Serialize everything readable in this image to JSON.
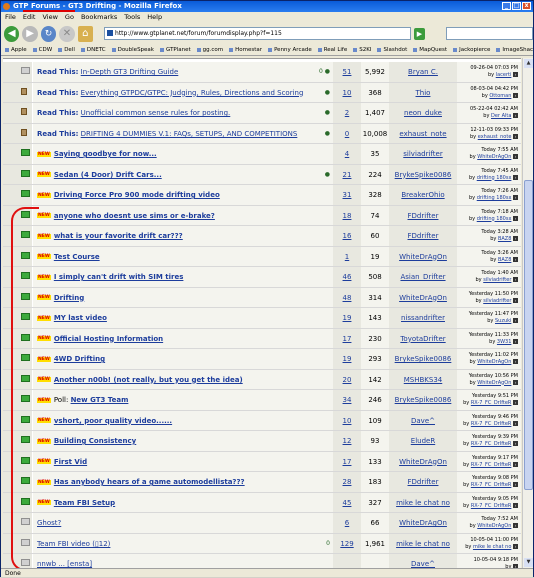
{
  "window": {
    "title_pre": "GTP Forums - ",
    "title_hl": "GT3 Drifting",
    "title_post": " - Mozilla Firefox",
    "min": "_",
    "max": "□",
    "close": "x"
  },
  "menu": [
    "File",
    "Edit",
    "View",
    "Go",
    "Bookmarks",
    "Tools",
    "Help"
  ],
  "nav": {
    "url": "http://www.gtplanet.net/forum/forumdisplay.php?f=115",
    "back_glyph": "◀",
    "fwd_glyph": "▶",
    "reload_glyph": "↻",
    "stop_glyph": "✕",
    "home_glyph": "⌂",
    "go_glyph": "▶"
  },
  "bookmarks": [
    "Apple",
    "CDW",
    "Dell",
    "DNETC",
    "DoubleSpeak",
    "GTPlanet",
    "gg.com",
    "Homestar",
    "Penny Arcade",
    "Real Life",
    "S2KI",
    "Slashdot",
    "MapQuest",
    "Jackopierce",
    "ImageShack"
  ],
  "status": "Done",
  "threads": [
    {
      "type": "readthis",
      "prefix": "Read This:",
      "title": "In-Depth GT3 Drifting Guide",
      "icons": "0 ●",
      "replies": "51",
      "views": "5,992",
      "author": "Bryan C.",
      "date": "09-26-04 07:03 PM",
      "by": "lacerti",
      "icon": "grey"
    },
    {
      "type": "readthis",
      "prefix": "Read This:",
      "title": "Everything GTPDC/GTPC: Judging, Rules, Directions and Scoring",
      "icons": "●",
      "replies": "10",
      "views": "368",
      "author": "Thio",
      "date": "08-03-04 04:42 PM",
      "by": "Ottoman",
      "icon": "lock"
    },
    {
      "type": "readthis",
      "prefix": "Read This:",
      "title": "Unofficial common sense rules for posting.",
      "icons": "●",
      "replies": "2",
      "views": "1,407",
      "author": "neon_duke",
      "date": "05-22-04 02:42 AM",
      "by": "Der Alta",
      "icon": "lock"
    },
    {
      "type": "readthis",
      "prefix": "Read This:",
      "title": "DRIFTING 4 DUMMIES V.1: FAQs, SETUPS, AND COMPETITIONS",
      "icons": "●",
      "replies": "0",
      "views": "10,008",
      "author": "exhaust_note",
      "date": "12-11-03 09:33 PM",
      "by": "exhaust_note",
      "icon": "lock"
    },
    {
      "type": "new",
      "title": "Saying goodbye for now...",
      "icons": "",
      "replies": "4",
      "views": "35",
      "author": "silviadrifter",
      "date": "Today 7:55 AM",
      "by": "WhiteDrAgOn",
      "icon": "green"
    },
    {
      "type": "new",
      "title": "Sedan (4 Door) Drift Cars...",
      "icons": "●",
      "replies": "21",
      "views": "224",
      "author": "BrykeSpike0086",
      "date": "Today 7:45 AM",
      "by": "drifting 180sx",
      "icon": "green"
    },
    {
      "type": "new",
      "title": "Driving Force Pro 900 mode drifting video",
      "icons": "",
      "replies": "31",
      "views": "328",
      "author": "BreakerOhio",
      "date": "Today 7:26 AM",
      "by": "drifting 180sx",
      "icon": "green"
    },
    {
      "type": "new",
      "title": "anyone who doesnt use sims or e-brake?",
      "icons": "",
      "replies": "18",
      "views": "74",
      "author": "FDdrifter",
      "date": "Today 7:18 AM",
      "by": "drifting 180sx",
      "icon": "green"
    },
    {
      "type": "new",
      "title": "what is your favorite drift car???",
      "icons": "",
      "replies": "16",
      "views": "60",
      "author": "FDdrifter",
      "date": "Today 3:28 AM",
      "by": "BAZ8",
      "icon": "green"
    },
    {
      "type": "new",
      "title": "Test Course",
      "icons": "",
      "replies": "1",
      "views": "19",
      "author": "WhiteDrAgOn",
      "date": "Today 3:26 AM",
      "by": "BAZ8",
      "icon": "green"
    },
    {
      "type": "new",
      "title": "I simply can't drift with SIM tires",
      "icons": "",
      "replies": "46",
      "views": "508",
      "author": "Asian_Drifter",
      "date": "Today 1:40 AM",
      "by": "silviadrifter",
      "icon": "green"
    },
    {
      "type": "new",
      "title": "Drifting",
      "icons": "",
      "replies": "48",
      "views": "314",
      "author": "WhiteDrAgOn",
      "date": "Yesterday 11:50 PM",
      "by": "silviadrifter",
      "icon": "green"
    },
    {
      "type": "new",
      "title": "MY last video",
      "icons": "",
      "replies": "19",
      "views": "143",
      "author": "nissandrifter",
      "date": "Yesterday 11:47 PM",
      "by": "Suzuki",
      "icon": "green"
    },
    {
      "type": "new",
      "title": "Official Hosting Information",
      "icons": "",
      "replies": "17",
      "views": "230",
      "author": "ToyotaDrifter",
      "date": "Yesterday 11:33 PM",
      "by": "3W31",
      "icon": "green"
    },
    {
      "type": "new",
      "title": "4WD Drifting",
      "icons": "",
      "replies": "19",
      "views": "293",
      "author": "BrykeSpike0086",
      "date": "Yesterday 11:02 PM",
      "by": "WhiteDrAgOn",
      "icon": "green"
    },
    {
      "type": "new",
      "title": "Another n00b! (not really, but you get the idea)",
      "icons": "",
      "replies": "20",
      "views": "142",
      "author": "MSHBKS34",
      "date": "Yesterday 10:56 PM",
      "by": "WhiteDrAgOn",
      "icon": "green"
    },
    {
      "type": "newpoll",
      "prefix": "Poll:",
      "title": "New GT3 Team",
      "icons": "",
      "replies": "34",
      "views": "246",
      "author": "BrykeSpike0086",
      "date": "Yesterday 9:51 PM",
      "by": "RX-7_FC_DrIfteR",
      "icon": "green"
    },
    {
      "type": "new",
      "title": "vshort, poor quality video......",
      "icons": "",
      "replies": "10",
      "views": "109",
      "author": "Dave^",
      "date": "Yesterday 9:46 PM",
      "by": "RX-7_FC_DrIfteR",
      "icon": "green"
    },
    {
      "type": "new",
      "title": "Building Consistency",
      "icons": "",
      "replies": "12",
      "views": "93",
      "author": "EludeR",
      "date": "Yesterday 9:39 PM",
      "by": "RX-7_FC_DrIfteR",
      "icon": "green"
    },
    {
      "type": "new",
      "title": "First Vid",
      "icons": "",
      "replies": "17",
      "views": "133",
      "author": "WhiteDrAgOn",
      "date": "Yesterday 9:17 PM",
      "by": "RX-7_FC_DrIfteR",
      "icon": "green"
    },
    {
      "type": "new",
      "title": "Has anybody hears of a game automodellista???",
      "icons": "",
      "replies": "28",
      "views": "183",
      "author": "FDdrifter",
      "date": "Yesterday 9:08 PM",
      "by": "RX-7_FC_DrIfteR",
      "icon": "green"
    },
    {
      "type": "new",
      "title": "Team FBI Setup",
      "icons": "",
      "replies": "45",
      "views": "327",
      "author": "mike le chat no",
      "date": "Yesterday 9:05 PM",
      "by": "RX-7_FC_DrIfteR",
      "icon": "green"
    },
    {
      "type": "old",
      "title": "Ghost?",
      "icons": "",
      "replies": "6",
      "views": "66",
      "author": "WhiteDrAgOn",
      "date": "Today 7:52 AM",
      "by": "WhiteDrAgOn",
      "icon": "grey"
    },
    {
      "type": "old",
      "title": "Team FBI video (▯12)",
      "icons": "0",
      "replies": "129",
      "views": "1,961",
      "author": "mike le chat no",
      "date": "10-05-04 11:00 PM",
      "by": "mike le chat no",
      "icon": "grey"
    },
    {
      "type": "old",
      "title": "nnwb ... [ensta]",
      "icons": "",
      "replies": "",
      "views": "",
      "author": "Dave^",
      "date": "10-05-04 9:18 PM",
      "by": "",
      "icon": "grey"
    }
  ],
  "new_label": "NEW",
  "by_label": "by"
}
